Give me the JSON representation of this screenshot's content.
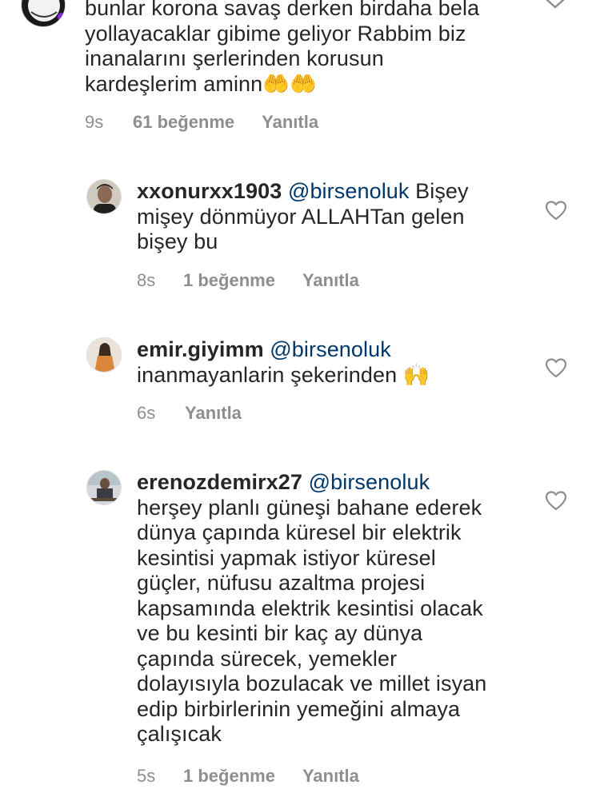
{
  "comments": [
    {
      "id": "c0",
      "lines": [
        "bunlar korona savaş derken birdaha bela",
        "yollayacaklar gibime geliyor Rabbim biz",
        "inanalarını şerlerinden korusun",
        "kardeşlerim aminn"
      ],
      "trailing_emoji": "🤲🤲",
      "time": "9s",
      "likes": "61 beğenme",
      "reply": "Yanıtla"
    },
    {
      "id": "c1",
      "username": "xxonurxx1903",
      "mention": "@birsenoluk",
      "first_line_rest": "Bişey",
      "lines": [
        "mişey dönmüyor ALLAHTan gelen",
        "bişey bu"
      ],
      "time": "8s",
      "likes": "1 beğenme",
      "reply": "Yanıtla"
    },
    {
      "id": "c2",
      "username": "emir.giyimm",
      "mention": "@birsenoluk",
      "lines": [
        "inanmayanlarin şekerinden"
      ],
      "trailing_emoji": "🙌",
      "time": "6s",
      "reply": "Yanıtla"
    },
    {
      "id": "c3",
      "username": "erenozdemirx27",
      "mention": "@birsenoluk",
      "lines": [
        "herşey planlı güneşi bahane ederek",
        "dünya çapında küresel bir elektrik",
        "kesintisi yapmak istiyor küresel",
        "güçler, nüfusu azaltma projesi",
        "kapsamında elektrik kesintisi olacak",
        "ve bu kesinti bir kaç ay dünya",
        "çapında sürecek, yemekler",
        "dolayısıyla bozulacak ve millet isyan",
        "edip birbirlerinin yemeğini almaya",
        "çalışıcak"
      ],
      "time": "5s",
      "likes": "1 beğenme",
      "reply": "Yanıtla"
    }
  ],
  "colors": {
    "text": "#262626",
    "mention": "#00376b",
    "meta": "#8e8e8e",
    "icon": "#8e8e8e"
  },
  "icons": {
    "like": "heart-icon",
    "collapse": "chevron-down-icon"
  }
}
